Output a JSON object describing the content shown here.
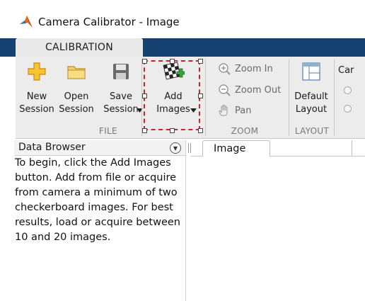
{
  "window": {
    "title": "Camera Calibrator - Image",
    "icon": "matlab-logo-icon"
  },
  "ribbon": {
    "tab": "CALIBRATION",
    "buttons": {
      "new_session": {
        "line1": "New",
        "line2": "Session",
        "icon": "new-session-icon"
      },
      "open_session": {
        "line1": "Open",
        "line2": "Session",
        "icon": "folder-icon"
      },
      "save_session": {
        "line1": "Save",
        "line2": "Session",
        "icon": "save-icon"
      },
      "add_images": {
        "line1": "Add",
        "line2": "Images",
        "icon": "add-images-icon"
      },
      "default_layout": {
        "line1": "Default",
        "line2": "Layout",
        "icon": "layout-icon"
      }
    },
    "zoom": {
      "zoom_in": "Zoom In",
      "zoom_out": "Zoom Out",
      "pan": "Pan"
    },
    "groups": {
      "file": "FILE",
      "zoom": "ZOOM",
      "layout": "LAYOUT"
    },
    "cropped_text": "Car"
  },
  "data_browser": {
    "title": "Data Browser",
    "help_lines": [
      "To begin, click the Add Images",
      "button. Add from file or acquire",
      "from camera a minimum of two",
      "checkerboard images. For best",
      "results, load or acquire between",
      "10 and 20 images."
    ]
  },
  "image_panel": {
    "tab_label": "Image"
  },
  "colors": {
    "ribbon_tab_strip": "#14416f",
    "ribbon_bg": "#ececec",
    "highlight": "#d2202a"
  }
}
